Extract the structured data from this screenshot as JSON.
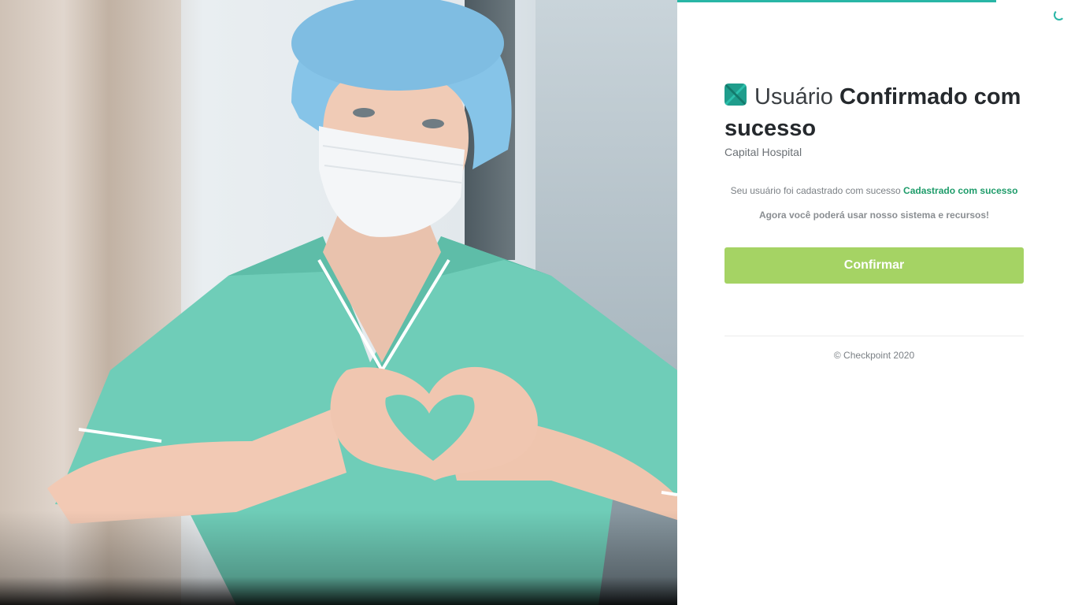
{
  "hero": {
    "image_description_icon": "nurse-heart-hands-photo"
  },
  "header": {
    "title_light": "Usuário",
    "title_bold": "Confirmado com sucesso",
    "subtitle": "Capital Hospital"
  },
  "message": {
    "line1_text": "Seu usuário foi cadastrado com sucesso",
    "line1_highlight": "Cadastrado com sucesso",
    "line2_text": "Agora você poderá usar nosso sistema e recursos!"
  },
  "actions": {
    "confirm_label": "Confirmar"
  },
  "footer": {
    "copyright": "© Checkpoint 2020"
  },
  "progress": {
    "loaded_fraction": 0.81
  },
  "colors": {
    "accent": "#29b6a6",
    "button": "#a5d364",
    "highlight": "#1e9c6a",
    "logo": "#1f9d8c"
  }
}
